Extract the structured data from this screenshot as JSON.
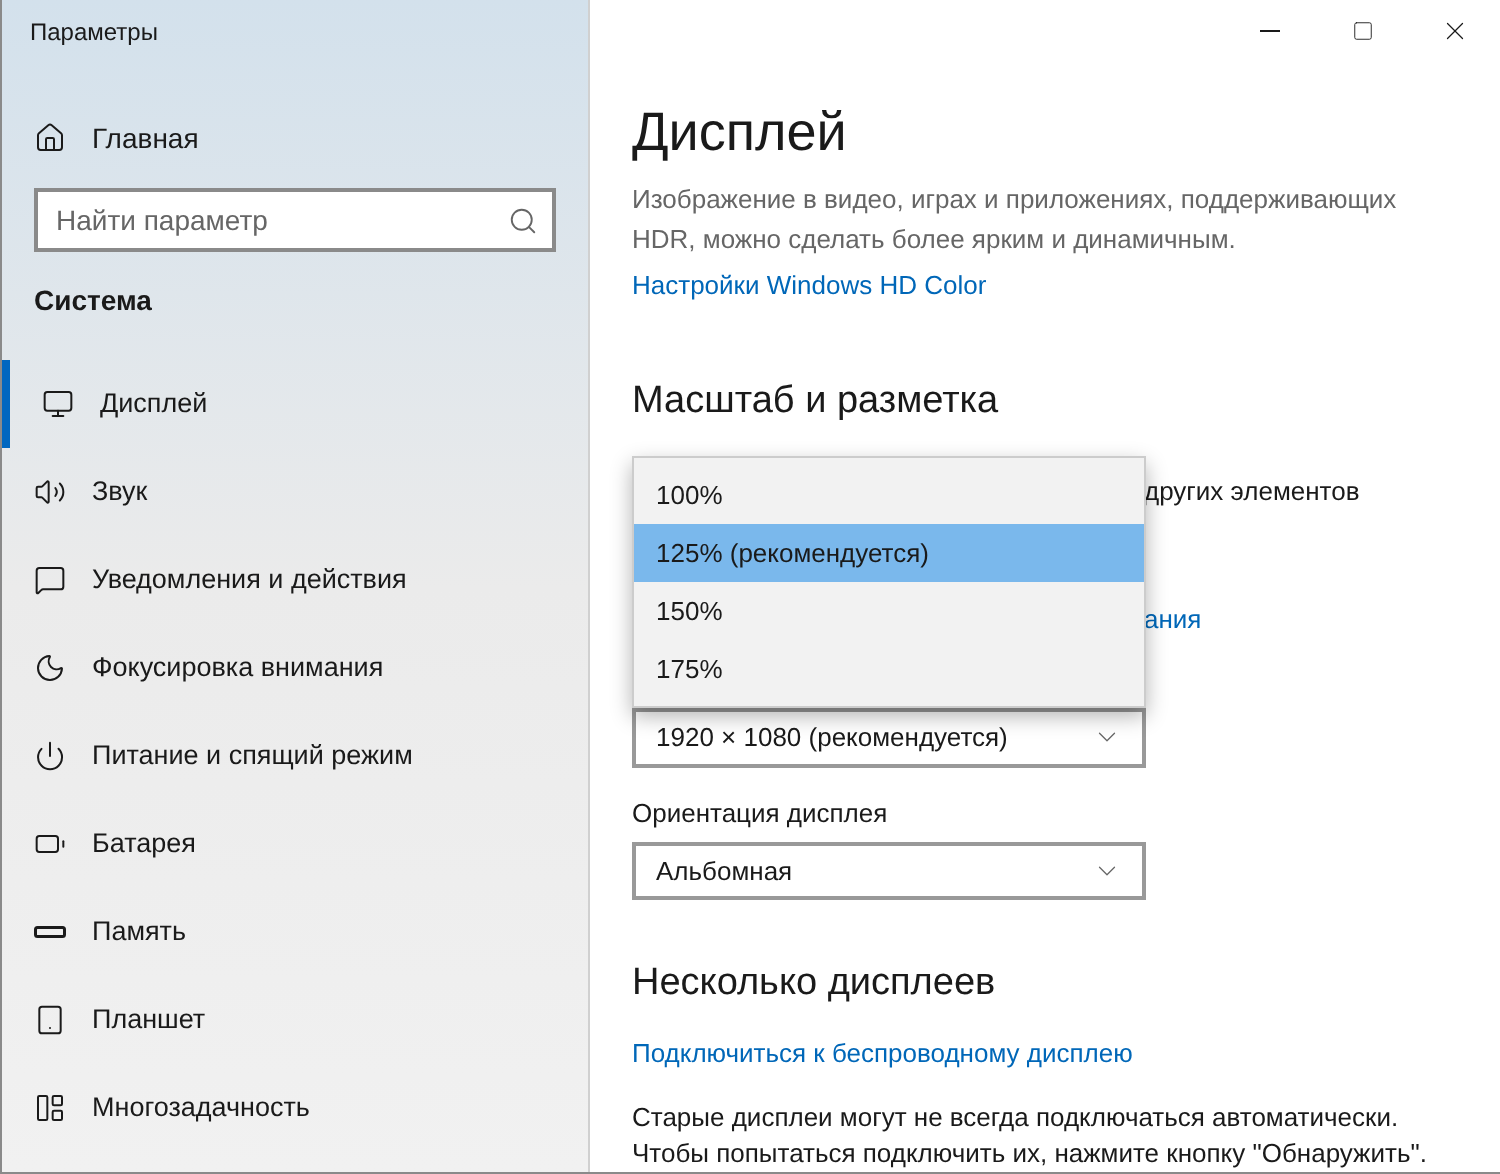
{
  "window": {
    "title": "Параметры"
  },
  "sidebar": {
    "home": "Главная",
    "search": {
      "placeholder": "Найти параметр"
    },
    "section": "Система",
    "items": [
      {
        "label": "Дисплей",
        "selected": true
      },
      {
        "label": "Звук",
        "selected": false
      },
      {
        "label": "Уведомления и действия",
        "selected": false
      },
      {
        "label": "Фокусировка внимания",
        "selected": false
      },
      {
        "label": "Питание и спящий режим",
        "selected": false
      },
      {
        "label": "Батарея",
        "selected": false
      },
      {
        "label": "Память",
        "selected": false
      },
      {
        "label": "Планшет",
        "selected": false
      },
      {
        "label": "Многозадачность",
        "selected": false
      }
    ]
  },
  "content": {
    "title": "Дисплей",
    "description": "Изображение в видео, играх и приложениях, поддерживающих HDR, можно сделать более ярким и динамичным.",
    "hdr_link": "Настройки Windows HD Color",
    "scale_section": {
      "title": "Масштаб и разметка",
      "hidden_text": "других элементов",
      "hidden_link": "ания",
      "scale_options": [
        {
          "label": "100%",
          "selected": false
        },
        {
          "label": "125% (рекомендуется)",
          "selected": true
        },
        {
          "label": "150%",
          "selected": false
        },
        {
          "label": "175%",
          "selected": false
        }
      ],
      "resolution": {
        "value": "1920 × 1080 (рекомендуется)"
      },
      "orientation": {
        "label": "Ориентация дисплея",
        "value": "Альбомная"
      }
    },
    "multi_section": {
      "title": "Несколько дисплеев",
      "link": "Подключиться к беспроводному дисплею",
      "text": "Старые дисплеи могут не всегда подключаться автоматически. Чтобы попытаться подключить их, нажмите кнопку \"Обнаружить\"."
    }
  }
}
